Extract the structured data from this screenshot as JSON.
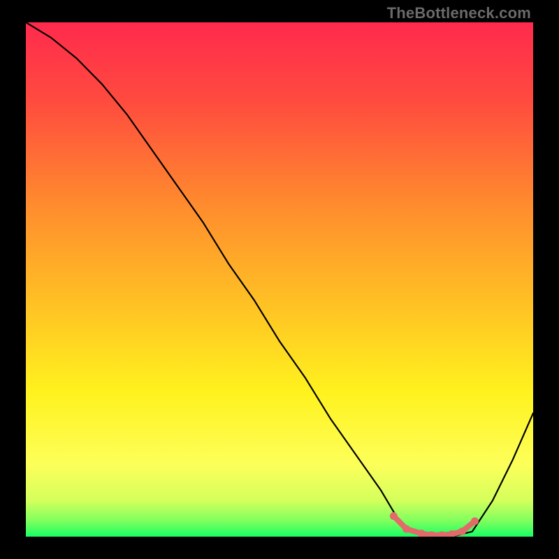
{
  "watermark": "TheBottleneck.com",
  "chart_data": {
    "type": "line",
    "title": "",
    "xlabel": "",
    "ylabel": "",
    "xlim": [
      0,
      100
    ],
    "ylim": [
      0,
      100
    ],
    "curve": {
      "name": "bottleneck-curve",
      "x": [
        0,
        5,
        10,
        15,
        20,
        25,
        30,
        35,
        40,
        45,
        50,
        55,
        60,
        65,
        70,
        73,
        76,
        80,
        84,
        88,
        92,
        96,
        100
      ],
      "y": [
        100,
        97,
        93,
        88,
        82,
        75,
        68,
        61,
        53,
        46,
        38,
        31,
        23,
        16,
        9,
        4,
        1,
        0,
        0,
        1,
        7,
        15,
        24
      ]
    },
    "highlight": {
      "name": "optimal-region",
      "color": "#e26a6a",
      "points_x": [
        72.5,
        75,
        78,
        80,
        82,
        84,
        86,
        88.5
      ],
      "points_y": [
        4.0,
        1.5,
        0.6,
        0.3,
        0.3,
        0.5,
        1.0,
        3.0
      ]
    },
    "gradient_stops": [
      {
        "offset": 0.0,
        "color": "#ff2a4d"
      },
      {
        "offset": 0.15,
        "color": "#ff4a3f"
      },
      {
        "offset": 0.35,
        "color": "#ff8a2e"
      },
      {
        "offset": 0.55,
        "color": "#ffc224"
      },
      {
        "offset": 0.72,
        "color": "#fff21e"
      },
      {
        "offset": 0.86,
        "color": "#fdff5a"
      },
      {
        "offset": 0.93,
        "color": "#d4ff5c"
      },
      {
        "offset": 0.97,
        "color": "#7dff5e"
      },
      {
        "offset": 1.0,
        "color": "#18ff64"
      }
    ]
  }
}
